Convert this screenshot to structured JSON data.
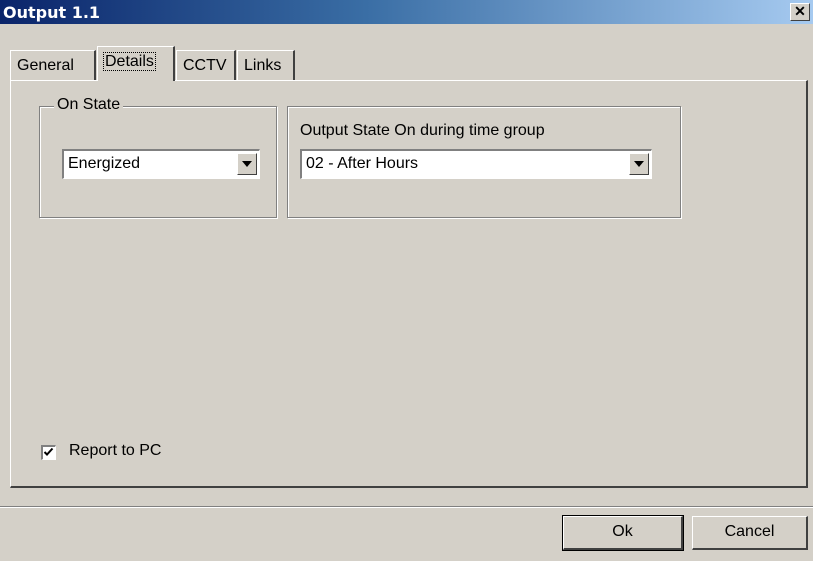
{
  "window": {
    "title": "Output 1.1"
  },
  "tabs": [
    {
      "label": "General"
    },
    {
      "label": "Details",
      "active": true
    },
    {
      "label": "CCTV"
    },
    {
      "label": "Links"
    }
  ],
  "on_state": {
    "legend": "On State",
    "selected": "Energized"
  },
  "time_group": {
    "label": "Output State On during time group",
    "selected": "02 - After Hours"
  },
  "report": {
    "label": "Report to PC",
    "checked": true
  },
  "buttons": {
    "ok": "Ok",
    "cancel": "Cancel"
  }
}
